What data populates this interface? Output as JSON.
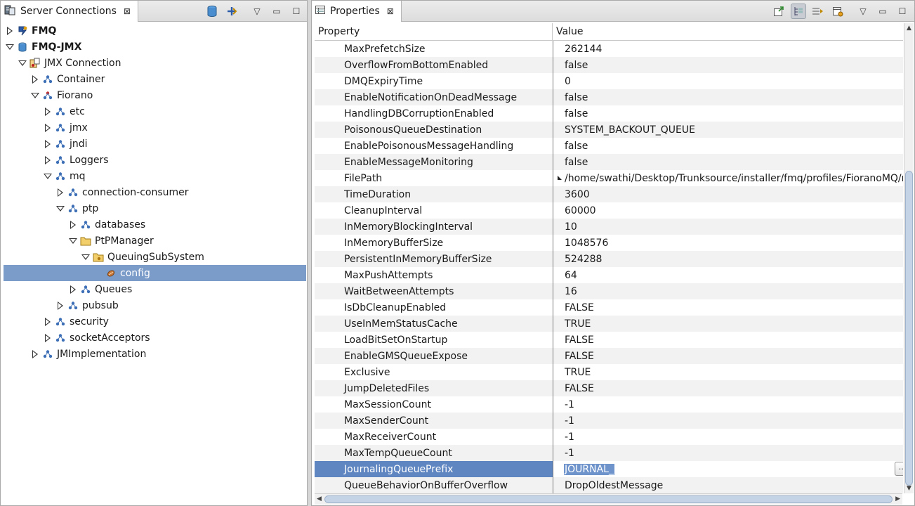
{
  "left_view": {
    "title": "Server Connections",
    "close": "⊠",
    "tree": [
      {
        "label": "FMQ",
        "indent": 0,
        "state": "collapsed",
        "icon": "server-fmq-icon",
        "bold": true
      },
      {
        "label": "FMQ-JMX",
        "indent": 0,
        "state": "expanded",
        "icon": "server-jmx-icon",
        "bold": true
      },
      {
        "label": "JMX Connection",
        "indent": 1,
        "state": "expanded",
        "icon": "jmx-connection-icon"
      },
      {
        "label": "Container",
        "indent": 2,
        "state": "collapsed",
        "icon": "mbean-domain-icon"
      },
      {
        "label": "Fiorano",
        "indent": 2,
        "state": "expanded",
        "icon": "mbean-domain-red-icon"
      },
      {
        "label": "etc",
        "indent": 3,
        "state": "collapsed",
        "icon": "mbean-domain-icon"
      },
      {
        "label": "jmx",
        "indent": 3,
        "state": "collapsed",
        "icon": "mbean-domain-icon"
      },
      {
        "label": "jndi",
        "indent": 3,
        "state": "collapsed",
        "icon": "mbean-domain-icon"
      },
      {
        "label": "Loggers",
        "indent": 3,
        "state": "collapsed",
        "icon": "mbean-domain-icon"
      },
      {
        "label": "mq",
        "indent": 3,
        "state": "expanded",
        "icon": "mbean-domain-icon"
      },
      {
        "label": "connection-consumer",
        "indent": 4,
        "state": "collapsed",
        "icon": "mbean-domain-icon"
      },
      {
        "label": "ptp",
        "indent": 4,
        "state": "expanded",
        "icon": "mbean-domain-icon"
      },
      {
        "label": "databases",
        "indent": 5,
        "state": "collapsed",
        "icon": "mbean-domain-icon"
      },
      {
        "label": "PtPManager",
        "indent": 5,
        "state": "expanded",
        "icon": "folder-icon"
      },
      {
        "label": "QueuingSubSystem",
        "indent": 6,
        "state": "expanded",
        "icon": "folder-bean-icon"
      },
      {
        "label": "config",
        "indent": 7,
        "state": "leaf",
        "icon": "config-bean-icon",
        "selected": true
      },
      {
        "label": "Queues",
        "indent": 5,
        "state": "collapsed",
        "icon": "mbean-domain-icon"
      },
      {
        "label": "pubsub",
        "indent": 4,
        "state": "collapsed",
        "icon": "mbean-domain-icon"
      },
      {
        "label": "security",
        "indent": 3,
        "state": "collapsed",
        "icon": "mbean-domain-icon"
      },
      {
        "label": "socketAcceptors",
        "indent": 3,
        "state": "collapsed",
        "icon": "mbean-domain-icon"
      },
      {
        "label": "JMImplementation",
        "indent": 2,
        "state": "collapsed",
        "icon": "mbean-domain-icon"
      }
    ]
  },
  "right_view": {
    "title": "Properties",
    "close": "⊠",
    "columns": {
      "property": "Property",
      "value": "Value"
    },
    "rows": [
      {
        "name": "MaxPrefetchSize",
        "value": "262144"
      },
      {
        "name": "OverflowFromBottomEnabled",
        "value": "false"
      },
      {
        "name": "DMQExpiryTime",
        "value": "0"
      },
      {
        "name": "EnableNotificationOnDeadMessage",
        "value": "false"
      },
      {
        "name": "HandlingDBCorruptionEnabled",
        "value": "false"
      },
      {
        "name": "PoisonousQueueDestination",
        "value": "SYSTEM_BACKOUT_QUEUE"
      },
      {
        "name": "EnablePoisonousMessageHandling",
        "value": "false"
      },
      {
        "name": "EnableMessageMonitoring",
        "value": "false"
      },
      {
        "name": "FilePath",
        "value": "/home/swathi/Desktop/Trunksource/installer/fmq/profiles/FioranoMQ/run/",
        "marker": true
      },
      {
        "name": "TimeDuration",
        "value": "3600"
      },
      {
        "name": "CleanupInterval",
        "value": "60000"
      },
      {
        "name": "InMemoryBlockingInterval",
        "value": "10"
      },
      {
        "name": "InMemoryBufferSize",
        "value": "1048576"
      },
      {
        "name": "PersistentInMemoryBufferSize",
        "value": "524288"
      },
      {
        "name": "MaxPushAttempts",
        "value": "64"
      },
      {
        "name": "WaitBetweenAttempts",
        "value": "16"
      },
      {
        "name": "IsDbCleanupEnabled",
        "value": "FALSE"
      },
      {
        "name": "UseInMemStatusCache",
        "value": "TRUE"
      },
      {
        "name": "LoadBitSetOnStartup",
        "value": "FALSE"
      },
      {
        "name": "EnableGMSQueueExpose",
        "value": "FALSE"
      },
      {
        "name": "Exclusive",
        "value": "TRUE"
      },
      {
        "name": "JumpDeletedFiles",
        "value": "FALSE"
      },
      {
        "name": "MaxSessionCount",
        "value": "-1"
      },
      {
        "name": "MaxSenderCount",
        "value": "-1"
      },
      {
        "name": "MaxReceiverCount",
        "value": "-1"
      },
      {
        "name": "MaxTempQueueCount",
        "value": "-1"
      },
      {
        "name": "JournalingQueuePrefix",
        "value": "JOURNAL_",
        "selected": true,
        "editing": true
      },
      {
        "name": "QueueBehaviorOnBufferOverflow",
        "value": "DropOldestMessage"
      }
    ],
    "edit_button": "..."
  },
  "colors": {
    "selection": "#7b9bc9",
    "row_alt": "#f2f2f2"
  }
}
